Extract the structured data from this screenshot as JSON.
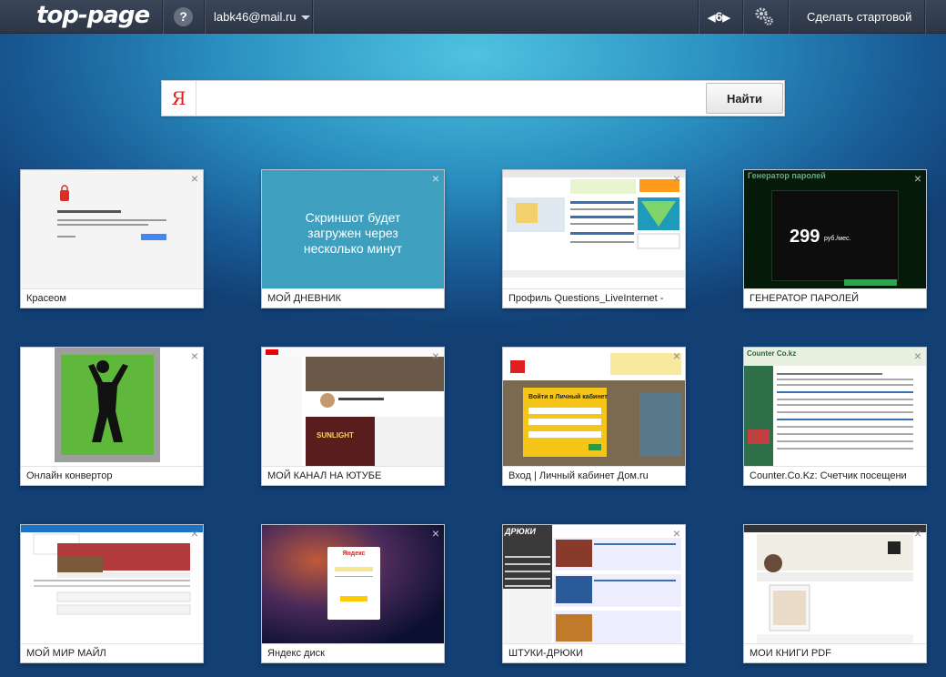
{
  "header": {
    "logo": "top-page",
    "help_icon": "?",
    "account": "labk46@mail.ru",
    "grid_size": "6",
    "set_homepage": "Сделать стартовой"
  },
  "search": {
    "engine_letter": "Я",
    "value": "",
    "button": "Найти"
  },
  "close_glyph": "×",
  "tiles": [
    {
      "label": "Красеом"
    },
    {
      "label": "МОЙ ДНЕВНИК",
      "placeholder": "Скриншот будет загружен через несколько минут"
    },
    {
      "label": "Профиль Questions_LiveInternet -"
    },
    {
      "label": "ГЕНЕРАТОР ПАРОЛЕЙ",
      "thumb_title": "Генератор паролей",
      "thumb_big": "299",
      "thumb_unit": "руб./мес."
    },
    {
      "label": "Онлайн конвертор"
    },
    {
      "label": "МОЙ КАНАЛ НА ЮТУБЕ",
      "thumb_text": "SUNLIGHT"
    },
    {
      "label": "Вход | Личный кабинет Дом.ru",
      "thumb_text": "Войти в Личный кабинет"
    },
    {
      "label": "Counter.Co.Kz: Счетчик посещени",
      "thumb_title": "Counter Co.kz"
    },
    {
      "label": "МОЙ МИР МАЙЛ"
    },
    {
      "label": "Яндекс диск",
      "thumb_text": "Яндекс"
    },
    {
      "label": "ШТУКИ-ДРЮКИ",
      "thumb_text": "ДРЮКИ"
    },
    {
      "label": "МОИ КНИГИ PDF"
    }
  ],
  "colors": {
    "accent_blue": "#2a8fc0",
    "header_bg": "#323d4e",
    "yandex_red": "#e02020",
    "placeholder_teal": "#3e9fbe"
  }
}
